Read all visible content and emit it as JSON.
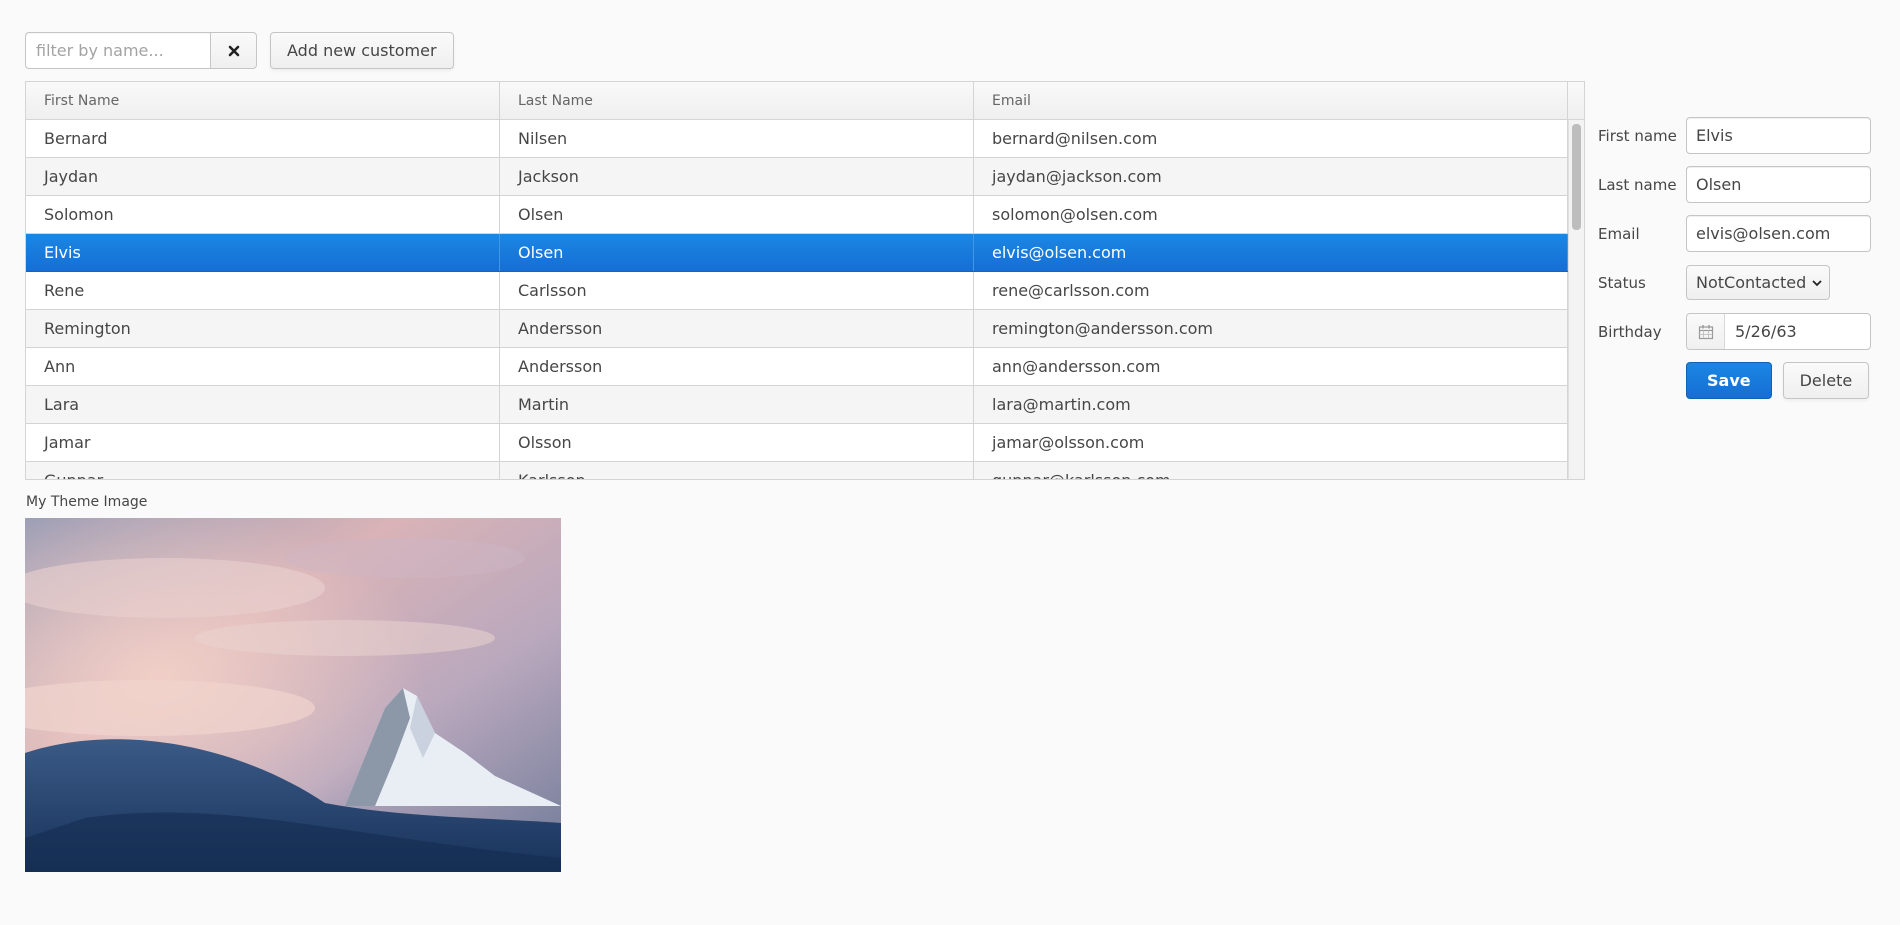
{
  "filter": {
    "placeholder": "filter by name..."
  },
  "icons": {
    "clear": "close-icon",
    "calendar": "calendar-icon",
    "select_arrow": "chevron-down-icon"
  },
  "toolbar": {
    "add_label": "Add new customer"
  },
  "grid": {
    "columns": [
      "First Name",
      "Last Name",
      "Email"
    ],
    "rows": [
      {
        "first": "Bernard",
        "last": "Nilsen",
        "email": "bernard@nilsen.com"
      },
      {
        "first": "Jaydan",
        "last": "Jackson",
        "email": "jaydan@jackson.com"
      },
      {
        "first": "Solomon",
        "last": "Olsen",
        "email": "solomon@olsen.com"
      },
      {
        "first": "Elvis",
        "last": "Olsen",
        "email": "elvis@olsen.com"
      },
      {
        "first": "Rene",
        "last": "Carlsson",
        "email": "rene@carlsson.com"
      },
      {
        "first": "Remington",
        "last": "Andersson",
        "email": "remington@andersson.com"
      },
      {
        "first": "Ann",
        "last": "Andersson",
        "email": "ann@andersson.com"
      },
      {
        "first": "Lara",
        "last": "Martin",
        "email": "lara@martin.com"
      },
      {
        "first": "Jamar",
        "last": "Olsson",
        "email": "jamar@olsson.com"
      },
      {
        "first": "Gunnar",
        "last": "Karlsson",
        "email": "gunnar@karlsson.com"
      }
    ],
    "selected_index": 3
  },
  "form": {
    "first_name_label": "First name",
    "first_name_value": "Elvis",
    "last_name_label": "Last name",
    "last_name_value": "Olsen",
    "email_label": "Email",
    "email_value": "elvis@olsen.com",
    "status_label": "Status",
    "status_value": "NotContacted",
    "birthday_label": "Birthday",
    "birthday_value": "5/26/63",
    "save_label": "Save",
    "delete_label": "Delete"
  },
  "theme": {
    "label": "My Theme Image"
  },
  "colors": {
    "selection": "#197de1",
    "background": "#fafafa"
  }
}
